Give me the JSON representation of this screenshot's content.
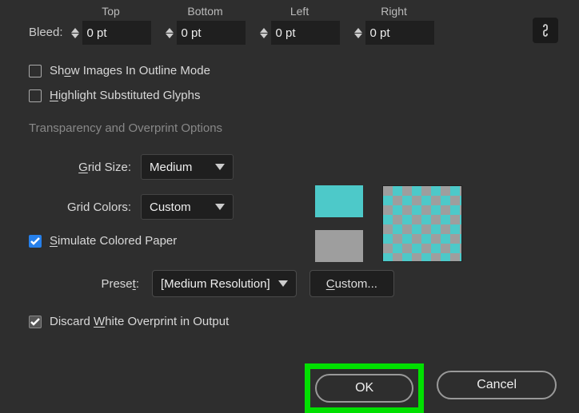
{
  "bleed": {
    "label": "Bleed:",
    "cols": [
      {
        "header": "Top",
        "value": "0 pt"
      },
      {
        "header": "Bottom",
        "value": "0 pt"
      },
      {
        "header": "Left",
        "value": "0 pt"
      },
      {
        "header": "Right",
        "value": "0 pt"
      }
    ]
  },
  "options": {
    "show_images": "Show Images In Outline Mode",
    "highlight_glyphs": "Highlight Substituted Glyphs"
  },
  "section": {
    "transparency": "Transparency and Overprint Options"
  },
  "grid_size": {
    "label": "Grid Size:",
    "value": "Medium"
  },
  "grid_colors": {
    "label": "Grid Colors:",
    "value": "Custom"
  },
  "simulate": {
    "label": "Simulate Colored Paper"
  },
  "preset": {
    "label": "Preset:",
    "value": "[Medium Resolution]",
    "custom": "Custom..."
  },
  "discard": {
    "label": "Discard White Overprint in Output"
  },
  "buttons": {
    "ok": "OK",
    "cancel": "Cancel"
  },
  "colors": {
    "teal": "#4dc9c9",
    "gray": "#9e9e9e"
  }
}
